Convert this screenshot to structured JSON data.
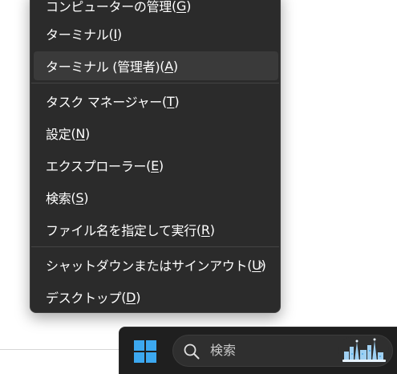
{
  "context_menu": {
    "items": [
      {
        "name": "menu-item-computer-management",
        "text": "コンピューターの管理",
        "accel": "G"
      },
      {
        "name": "menu-item-terminal",
        "text": "ターミナル",
        "accel": "I"
      },
      {
        "name": "menu-item-terminal-admin",
        "text": "ターミナル (管理者)",
        "accel": "A"
      },
      {
        "name": "menu-item-task-manager",
        "text": "タスク マネージャー",
        "accel": "T"
      },
      {
        "name": "menu-item-settings",
        "text": "設定",
        "accel": "N"
      },
      {
        "name": "menu-item-explorer",
        "text": "エクスプローラー",
        "accel": "E"
      },
      {
        "name": "menu-item-search",
        "text": "検索",
        "accel": "S"
      },
      {
        "name": "menu-item-run",
        "text": "ファイル名を指定して実行",
        "accel": "R"
      },
      {
        "name": "menu-item-shutdown-signout",
        "text": "シャットダウンまたはサインアウト",
        "accel": "U"
      },
      {
        "name": "menu-item-desktop",
        "text": "デスクトップ",
        "accel": "D"
      }
    ]
  },
  "taskbar": {
    "search_placeholder": "検索",
    "start_icon": "windows-logo-icon",
    "search_icon": "search-icon"
  },
  "colors": {
    "menu_bg": "#2b2b2b",
    "menu_hover": "#3a3a3a",
    "taskbar_bg": "#1f1f1f",
    "windows_logo": "#3ca8f0"
  }
}
